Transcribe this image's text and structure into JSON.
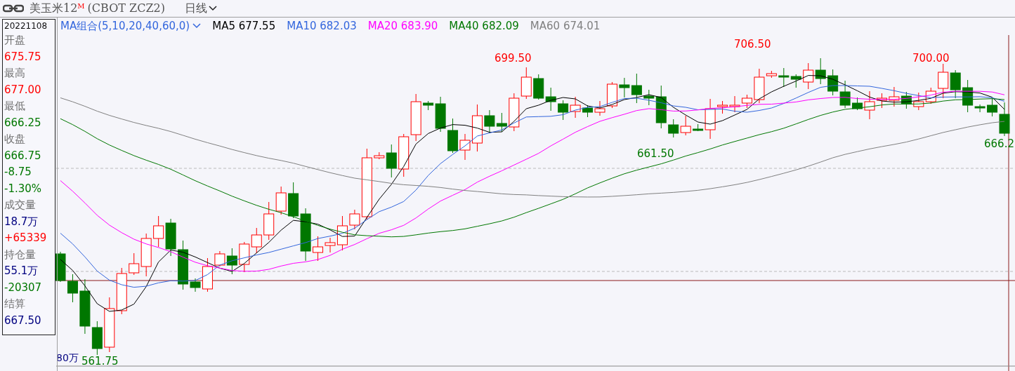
{
  "title": {
    "name": "美玉米12",
    "superscript": "M",
    "code": "(CBOT ZCZ2)"
  },
  "period": "日线",
  "ma_selector": "MA组合(5,10,20,40,60,0)",
  "ma_legend": [
    {
      "label": "MA5 677.55",
      "color": "#000000"
    },
    {
      "label": "MA10 682.03",
      "color": "#3366dd"
    },
    {
      "label": "MA20 683.90",
      "color": "#ff00ff"
    },
    {
      "label": "MA40 682.09",
      "color": "#007700"
    },
    {
      "label": "MA60 674.01",
      "color": "#808080"
    }
  ],
  "info_panel": {
    "date": "20221108",
    "rows": [
      {
        "text": "开盘",
        "color": "#707070"
      },
      {
        "text": "675.75",
        "color": "#ff0000"
      },
      {
        "text": "最高",
        "color": "#707070"
      },
      {
        "text": "677.00",
        "color": "#ff0000"
      },
      {
        "text": "最低",
        "color": "#707070"
      },
      {
        "text": "666.25",
        "color": "#007700"
      },
      {
        "text": "收盘",
        "color": "#707070"
      },
      {
        "text": "666.75",
        "color": "#007700"
      },
      {
        "text": "-8.75",
        "color": "#007700"
      },
      {
        "text": "-1.30%",
        "color": "#007700"
      },
      {
        "text": "成交量",
        "color": "#707070"
      },
      {
        "text": "18.7万",
        "color": "#000080"
      },
      {
        "text": "+65339",
        "color": "#ff0000"
      },
      {
        "text": "持仓量",
        "color": "#707070"
      },
      {
        "text": "55.1万",
        "color": "#000080"
      },
      {
        "text": "-20307",
        "color": "#007700"
      },
      {
        "text": "结算",
        "color": "#707070"
      },
      {
        "text": "667.50",
        "color": "#000080"
      }
    ]
  },
  "annotations": [
    {
      "text": "699.50",
      "kind": "high"
    },
    {
      "text": "706.50",
      "kind": "high"
    },
    {
      "text": "700.00",
      "kind": "high"
    },
    {
      "text": "661.50",
      "kind": "low"
    },
    {
      "text": "666.2",
      "kind": "low"
    },
    {
      "text": "561.75",
      "kind": "low"
    }
  ],
  "volume_axis_label": "80万"
}
